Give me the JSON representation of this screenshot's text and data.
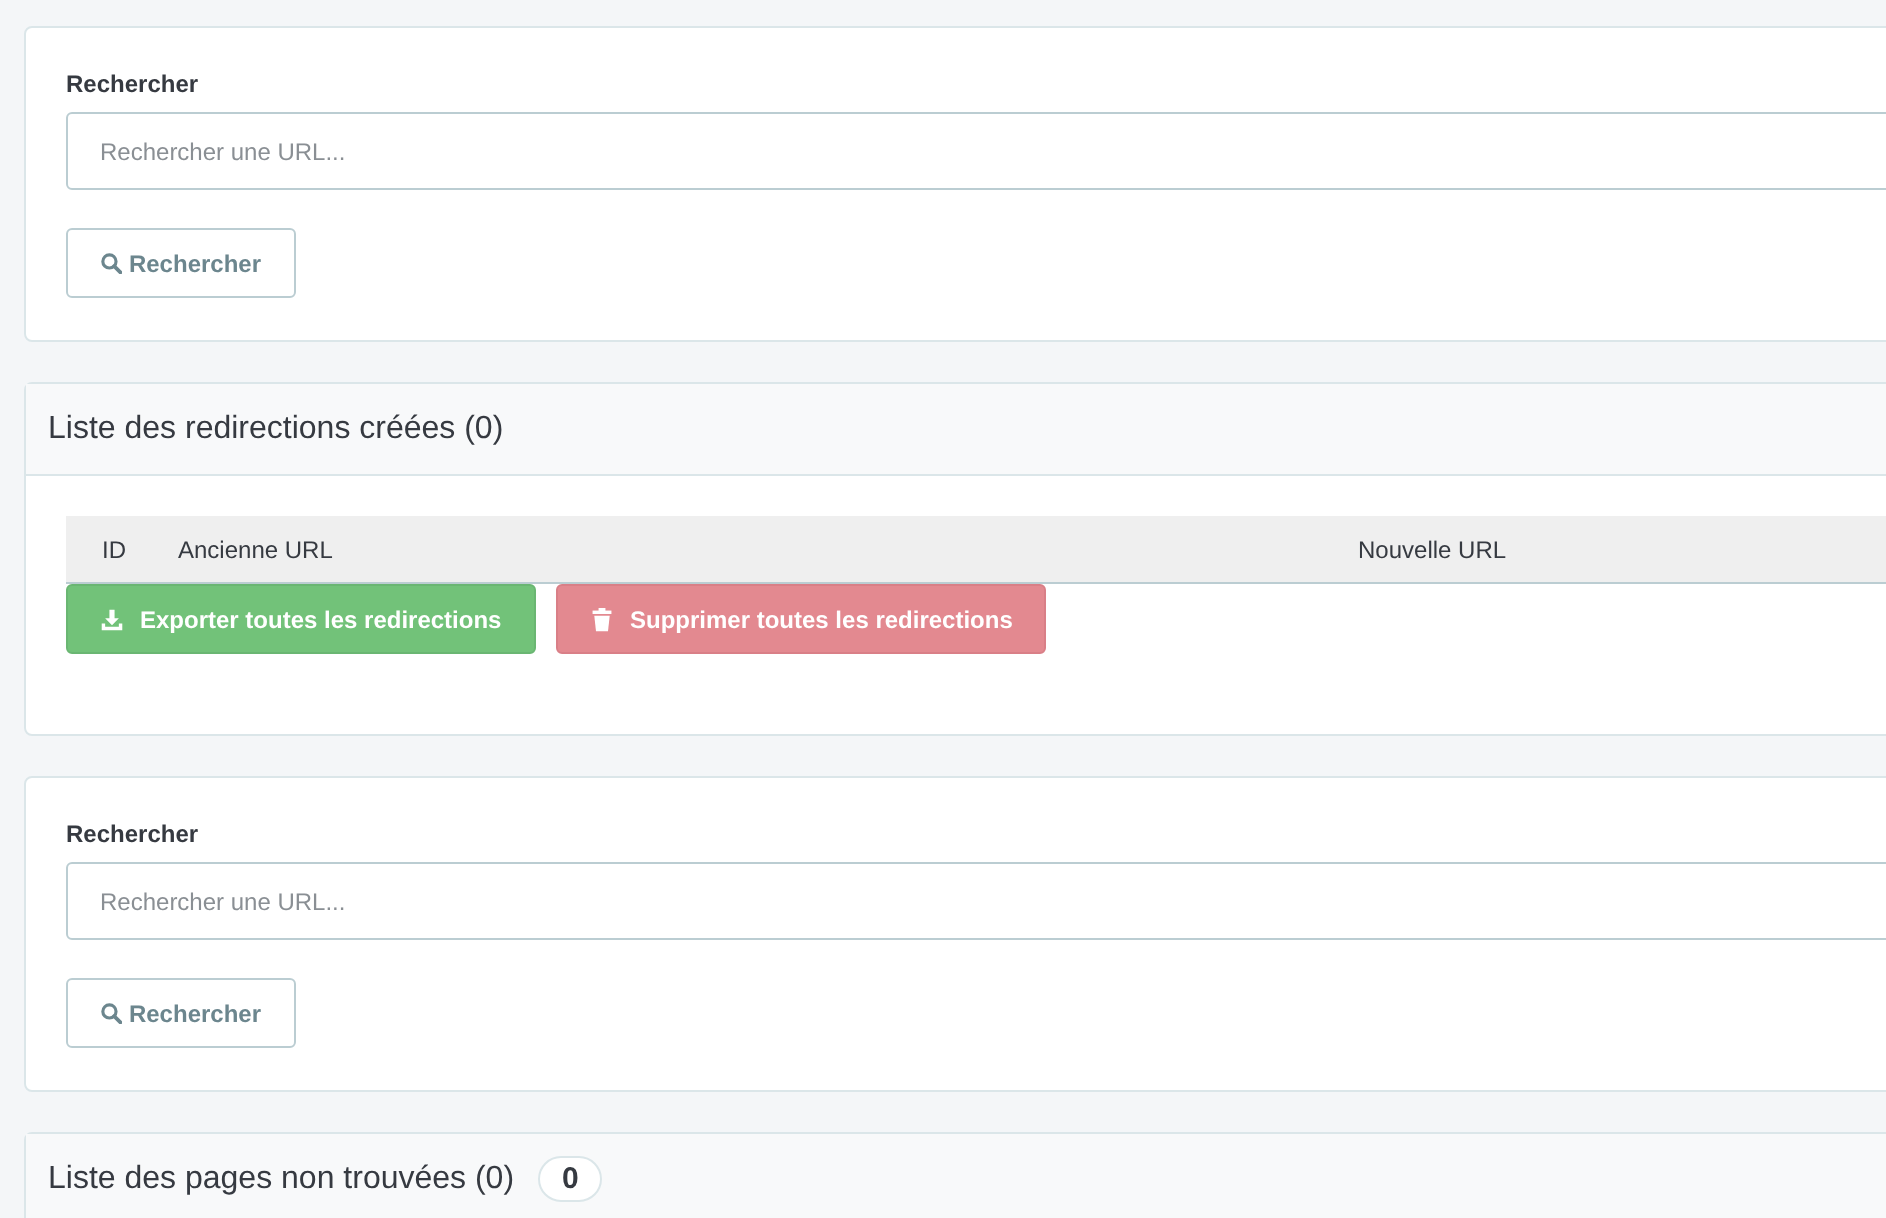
{
  "sections": [
    {
      "kind": "search",
      "label": "Rechercher",
      "placeholder": "Rechercher une URL...",
      "button": "Rechercher"
    },
    {
      "kind": "list",
      "title": "Liste des redirections créées (0)",
      "columns": [
        "ID",
        "Ancienne URL",
        "Nouvelle URL"
      ],
      "buttons": [
        {
          "kind": "export",
          "label": "Exporter toutes les redirections"
        },
        {
          "kind": "delete",
          "label": "Supprimer toutes les redirections"
        }
      ]
    },
    {
      "kind": "search",
      "label": "Rechercher",
      "placeholder": "Rechercher une URL...",
      "button": "Rechercher"
    },
    {
      "kind": "list",
      "title": "Liste des pages non trouvées (0)",
      "badge": "0"
    }
  ]
}
